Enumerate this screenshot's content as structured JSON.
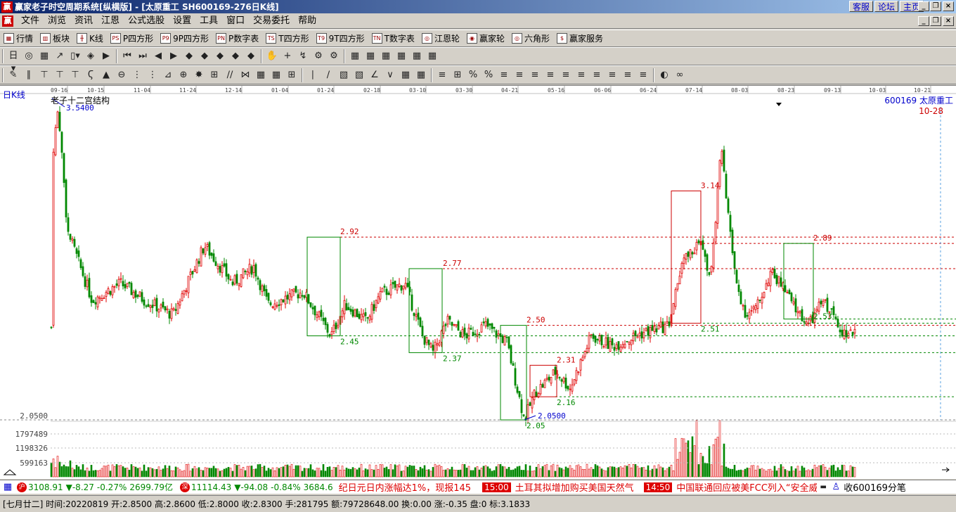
{
  "window": {
    "title": "赢家老子时空周期系统[纵横版] - [太原重工   SH600169-276日K线]",
    "links": [
      "客服",
      "论坛",
      "主页"
    ]
  },
  "menu": [
    "文件",
    "浏览",
    "资讯",
    "江恩",
    "公式选股",
    "设置",
    "工具",
    "窗口",
    "交易委托",
    "帮助"
  ],
  "toolbar1": [
    {
      "icon": "table-icon",
      "glyph": "▦",
      "label": "行情"
    },
    {
      "icon": "blocks-icon",
      "glyph": "▥",
      "label": "板块"
    },
    {
      "icon": "kline-icon",
      "glyph": "╫",
      "label": "K线"
    },
    {
      "icon": "p-square-icon",
      "glyph": "PS",
      "label": "P四方形"
    },
    {
      "icon": "p9-square-icon",
      "glyph": "P9",
      "label": "9P四方形"
    },
    {
      "icon": "p-number-icon",
      "glyph": "PN",
      "label": "P数字表"
    },
    {
      "icon": "t-square-icon",
      "glyph": "TS",
      "label": "T四方形"
    },
    {
      "icon": "t9-square-icon",
      "glyph": "T9",
      "label": "9T四方形"
    },
    {
      "icon": "t-number-icon",
      "glyph": "TN",
      "label": "T数字表"
    },
    {
      "icon": "gann-wheel-icon",
      "glyph": "◎",
      "label": "江恩轮"
    },
    {
      "icon": "winner-wheel-icon",
      "glyph": "◉",
      "label": "赢家轮"
    },
    {
      "icon": "hexagon-icon",
      "glyph": "◎",
      "label": "六角形"
    },
    {
      "icon": "dollar-icon",
      "glyph": "$",
      "label": "赢家服务"
    }
  ],
  "toolbar2": [
    "日▾",
    "◎",
    "▦",
    "↗",
    "▯▾",
    "◈",
    "▶",
    "⏮",
    "⏭",
    "◀",
    "▶",
    "◆",
    "◆",
    "◆",
    "◆",
    "◆",
    "✋",
    "+",
    "↯",
    "⚙",
    "⚙",
    "▦",
    "▦",
    "▦",
    "▦",
    "▦",
    "▦"
  ],
  "toolbar3": [
    "✎",
    "∥",
    "⊤",
    "⊤",
    "⊤",
    "Ϛ",
    "▲",
    "⊖",
    "⋮",
    "⋮",
    "⊿",
    "⊕",
    "✸",
    "⊞",
    "∕∕",
    "⋈",
    "▦",
    "▦",
    "⊞",
    "∣",
    "∕",
    "▧",
    "▧",
    "∠",
    "∨",
    "▦",
    "▦",
    "≡",
    "⊞",
    "%",
    "%",
    "≡",
    "≡",
    "≡",
    "≡",
    "≡",
    "≡",
    "≡",
    "≡",
    "≡",
    "≡",
    "◐",
    "∞"
  ],
  "chart": {
    "period_label": "日K线",
    "title": "老子十二宫结构",
    "code": "600169  太原重工",
    "date_corner": "10-28",
    "date_ticks": [
      "09-16",
      "10-15",
      "11-04",
      "11-24",
      "12-14",
      "01-04",
      "01-24",
      "02-18",
      "03-10",
      "03-30",
      "04-21",
      "05-16",
      "06-06",
      "06-24",
      "07-14",
      "08-03",
      "08-23",
      "09-13",
      "10-03",
      "10-21"
    ],
    "high_label": "3.5400",
    "low_label": "2.0500",
    "low_axis_label": "2.0500",
    "box_labels": [
      "2.92",
      "2.45",
      "2.77",
      "2.37",
      "2.50",
      "2.05",
      "2.31",
      "2.16",
      "3.14",
      "2.51",
      "2.89",
      "2.53"
    ],
    "volume_ticks": [
      "1797489",
      "1198326",
      "599163"
    ]
  },
  "ticker": {
    "sh_index": "3108.91",
    "sh_change": "▼-8.27",
    "sh_pct": "-0.27%",
    "sh_amount": "2699.79亿",
    "sz_index": "11114.43",
    "sz_change": "▼-94.08",
    "sz_pct": "-0.84%",
    "sz_amount": "3684.6",
    "news1": "纪日元日内涨幅达1%，现报145",
    "time2": "15:00",
    "news2": "土耳其拟增加购买美国天然气",
    "time3": "14:50",
    "news3": "中国联通回应被美FCC列入“安全威胁",
    "right": "收600169分笔"
  },
  "status": "[七月廿二] 时间:20220819 开:2.8500 高:2.8600 低:2.8000 收:2.8300 手:281795 额:79728648.00 换:0.00 涨:-0.35 盘:0 标:3.1833"
}
